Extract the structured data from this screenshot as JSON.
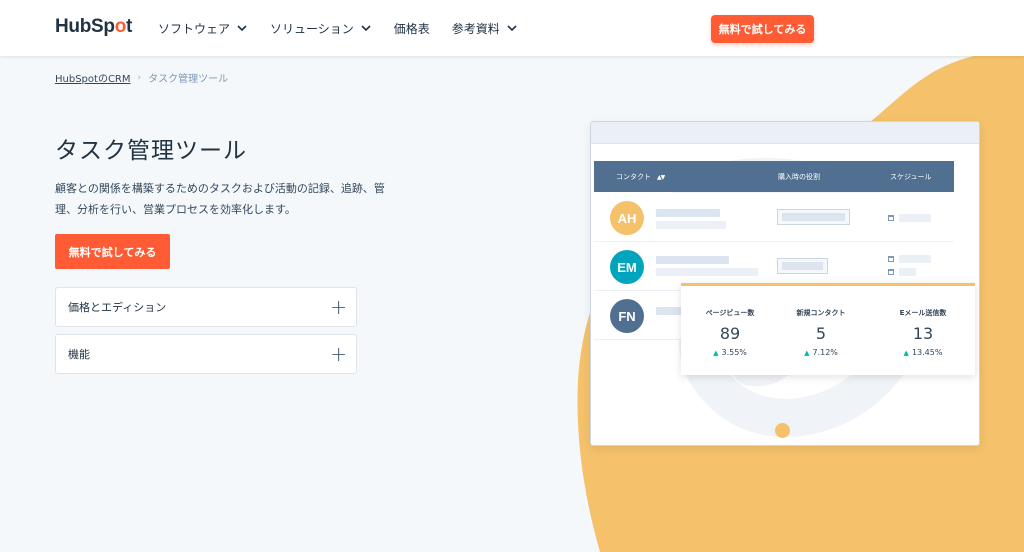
{
  "header": {
    "logo_text_a": "HubSp",
    "logo_text_o": "o",
    "logo_text_b": "t",
    "nav": [
      {
        "label": "ソフトウェア",
        "has_dropdown": true
      },
      {
        "label": "ソリューション",
        "has_dropdown": true
      },
      {
        "label": "価格表",
        "has_dropdown": false
      },
      {
        "label": "参考資料",
        "has_dropdown": true
      }
    ],
    "cta_label": "無料で試してみる"
  },
  "breadcrumb": {
    "parent": "HubSpotのCRM",
    "separator": "›",
    "current": "タスク管理ツール"
  },
  "hero": {
    "title": "タスク管理ツール",
    "description": "顧客との関係を構築するためのタスクおよび活動の記録、追跡、管理、分析を行い、営業プロセスを効率化します。",
    "cta_label": "無料で試してみる"
  },
  "accordions": [
    {
      "label": "価格とエディション",
      "icon": "plus-icon"
    },
    {
      "label": "機能",
      "icon": "plus-icon"
    }
  ],
  "mockup": {
    "columns": [
      "コンタクト",
      "購入時の役割",
      "スケジュール"
    ],
    "sort_glyph": "▲▼",
    "rows": [
      {
        "initials": "AH",
        "color": "#f5c26b"
      },
      {
        "initials": "EM",
        "color": "#00a4bd"
      },
      {
        "initials": "FN",
        "color": "#516f90"
      }
    ],
    "stats": [
      {
        "label": "ページビュー数",
        "value": "89",
        "change": "3.55%"
      },
      {
        "label": "新規コンタクト",
        "value": "5",
        "change": "7.12%"
      },
      {
        "label": "Eメール送信数",
        "value": "13",
        "change": "13.45%"
      }
    ],
    "up_arrow": "▲"
  },
  "colors": {
    "accent": "#ff5c35",
    "blob": "#f5c26b",
    "table_header": "#516f90",
    "positive": "#00bda5"
  }
}
